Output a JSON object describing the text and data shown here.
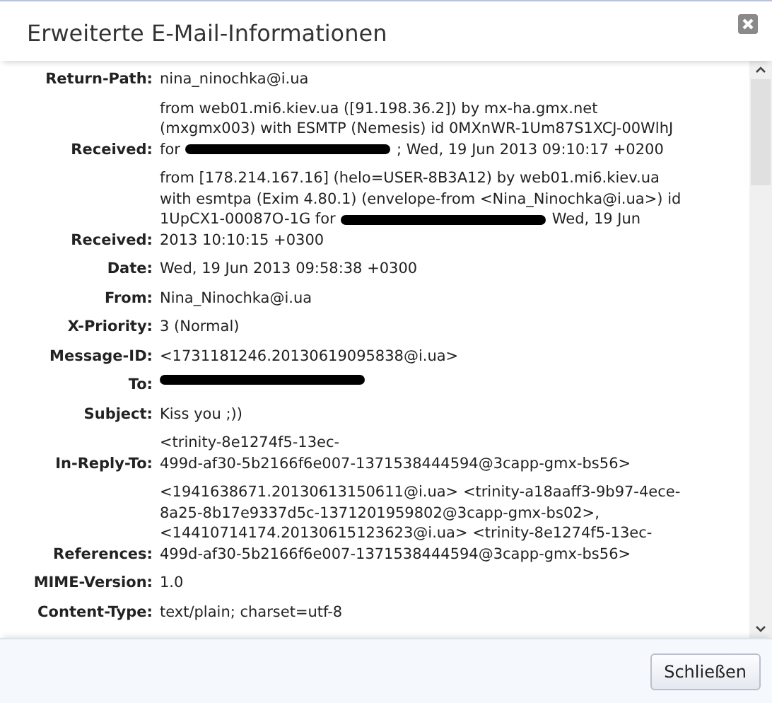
{
  "dialog": {
    "title": "Erweiterte E-Mail-Informationen"
  },
  "headers": [
    {
      "label": "Return-Path:",
      "lines": [
        [
          {
            "kind": "text",
            "text": "nina_ninochka@i.ua"
          }
        ]
      ]
    },
    {
      "label": "Received:",
      "lines": [
        [
          {
            "kind": "text",
            "text": "from web01.mi6.kiev.ua ([91.198.36.2]) by mx-ha.gmx.net"
          }
        ],
        [
          {
            "kind": "text",
            "text": "(mxgmx003) with ESMTP (Nemesis) id 0MXnWR-1Um87S1XCJ-00WlhJ"
          }
        ],
        [
          {
            "kind": "text",
            "text": "for"
          },
          {
            "kind": "redaction"
          },
          {
            "kind": "text",
            "text": "; Wed, 19 Jun 2013 09:10:17 +0200"
          }
        ]
      ]
    },
    {
      "label": "Received:",
      "lines": [
        [
          {
            "kind": "text",
            "text": "from [178.214.167.16] (helo=USER-8B3A12) by web01.mi6.kiev.ua"
          }
        ],
        [
          {
            "kind": "text",
            "text": "with esmtpa (Exim 4.80.1) (envelope-from <Nina_Ninochka@i.ua>) id"
          }
        ],
        [
          {
            "kind": "text",
            "text": "1UpCX1-00087O-1G for"
          },
          {
            "kind": "redaction"
          },
          {
            "kind": "text",
            "text": "Wed, 19 Jun"
          }
        ],
        [
          {
            "kind": "text",
            "text": "2013 10:10:15 +0300"
          }
        ]
      ]
    },
    {
      "label": "Date:",
      "lines": [
        [
          {
            "kind": "text",
            "text": "Wed, 19 Jun 2013 09:58:38 +0300"
          }
        ]
      ]
    },
    {
      "label": "From:",
      "lines": [
        [
          {
            "kind": "text",
            "text": "Nina_Ninochka@i.ua"
          }
        ]
      ]
    },
    {
      "label": "X-Priority:",
      "lines": [
        [
          {
            "kind": "text",
            "text": "3 (Normal)"
          }
        ]
      ]
    },
    {
      "label": "Message-ID:",
      "lines": [
        [
          {
            "kind": "text",
            "text": "<1731181246.20130619095838@i.ua>"
          }
        ]
      ]
    },
    {
      "label": "To:",
      "lines": [
        [
          {
            "kind": "redaction"
          }
        ]
      ]
    },
    {
      "label": "Subject:",
      "lines": [
        [
          {
            "kind": "text",
            "text": "Kiss you ;))"
          }
        ]
      ]
    },
    {
      "label": "In-Reply-To:",
      "lines": [
        [
          {
            "kind": "text",
            "text": "<trinity-8e1274f5-13ec-"
          }
        ],
        [
          {
            "kind": "text",
            "text": "499d-af30-5b2166f6e007-1371538444594@3capp-gmx-bs56>"
          }
        ]
      ]
    },
    {
      "label": "References:",
      "lines": [
        [
          {
            "kind": "text",
            "text": "<1941638671.20130613150611@i.ua> <trinity-a18aaff3-9b97-4ece-"
          }
        ],
        [
          {
            "kind": "text",
            "text": "8a25-8b17e9337d5c-1371201959802@3capp-gmx-bs02>,"
          }
        ],
        [
          {
            "kind": "text",
            "text": "<14410714174.20130615123623@i.ua> <trinity-8e1274f5-13ec-"
          }
        ],
        [
          {
            "kind": "text",
            "text": "499d-af30-5b2166f6e007-1371538444594@3capp-gmx-bs56>"
          }
        ]
      ]
    },
    {
      "label": "MIME-Version:",
      "lines": [
        [
          {
            "kind": "text",
            "text": "1.0"
          }
        ]
      ]
    },
    {
      "label": "Content-Type:",
      "lines": [
        [
          {
            "kind": "text",
            "text": "text/plain; charset=utf-8"
          }
        ]
      ]
    }
  ],
  "buttons": [
    {
      "label": "Schließen"
    }
  ]
}
